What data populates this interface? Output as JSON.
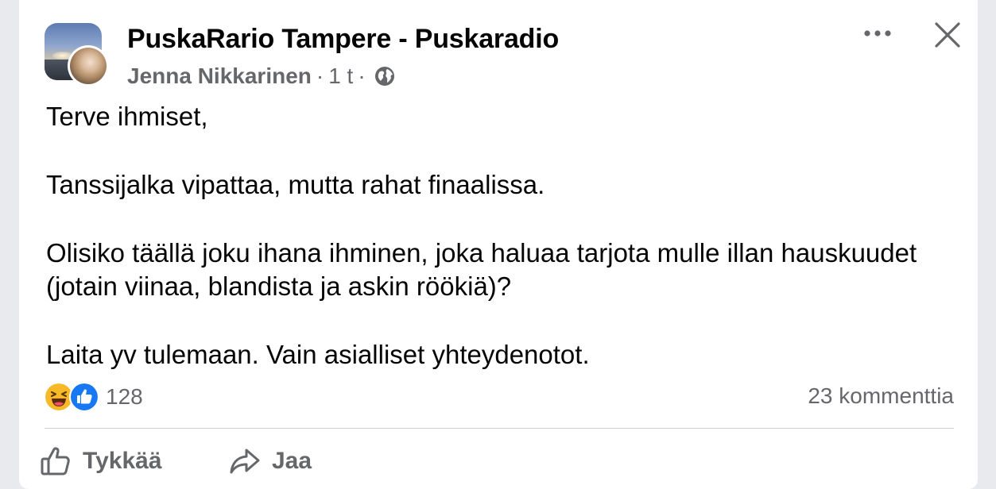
{
  "post": {
    "group_name": "PuskaRario Tampere - Puskaradio",
    "author": "Jenna Nikkarinen",
    "separator": "·",
    "time": "1 t",
    "audience_icon": "globe-icon",
    "paragraphs": [
      "Terve ihmiset,",
      "Tanssijalka vipattaa, mutta rahat finaalissa.",
      "Olisiko täällä joku ihana ihminen, joka haluaa tarjota mulle illan hauskuudet (jotain viinaa, blandista ja askin röökiä)?",
      "Laita yv tulemaan. Vain asialliset yhteydenotot."
    ]
  },
  "header_actions": {
    "more_icon": "more-horizontal-icon",
    "close_icon": "close-icon"
  },
  "stats": {
    "reaction_icons": [
      "haha-reaction-icon",
      "like-reaction-icon"
    ],
    "reaction_count": "128",
    "comment_count": "23 kommenttia"
  },
  "actions": {
    "like_label": "Tykkää",
    "like_icon": "thumbs-up-icon",
    "share_label": "Jaa",
    "share_icon": "share-arrow-icon"
  },
  "colors": {
    "text_primary": "#050505",
    "text_secondary": "#65676b",
    "divider": "#ced0d4",
    "like_blue": "#1877f2",
    "haha_yellow": "#f7b928"
  }
}
